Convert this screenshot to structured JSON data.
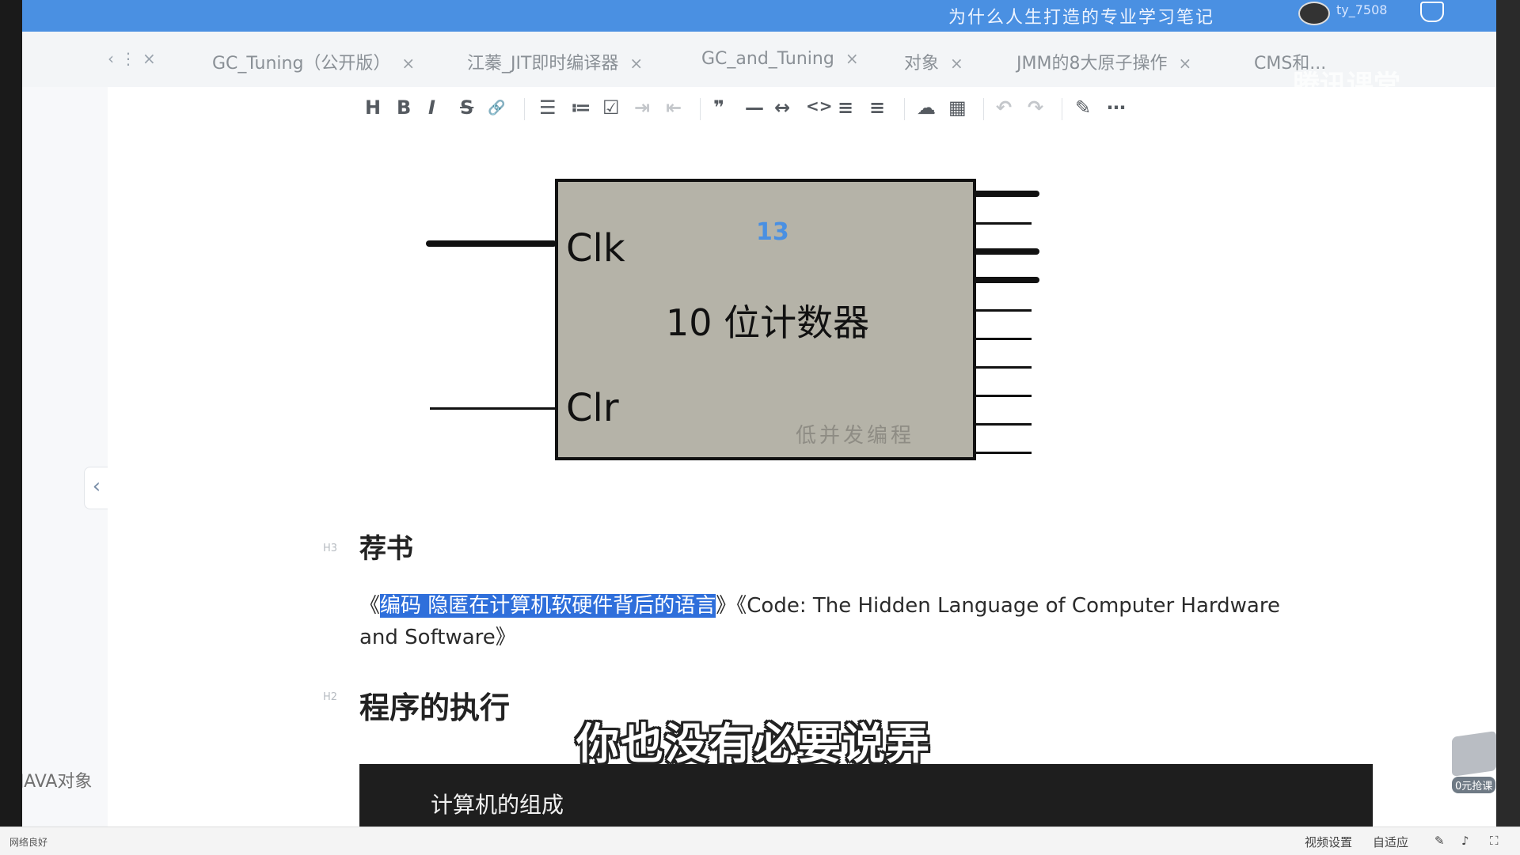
{
  "window": {
    "title": "为什么人生打造的专业学习笔记",
    "username": "ty_7508"
  },
  "tabs": [
    {
      "label": "GC_Tuning（公开版）"
    },
    {
      "label": "江蓁_JIT即时编译器"
    },
    {
      "label": "GC_and_Tuning"
    },
    {
      "label": "对象"
    },
    {
      "label": "JMM的8大原子操作"
    },
    {
      "label": "CMS和..."
    }
  ],
  "tab_nav": {
    "prev": "‹",
    "more": "⋮",
    "close": "×"
  },
  "watermark": "腾讯课堂",
  "sidebar": {
    "item": "JAVA对象",
    "collapse": "‹"
  },
  "toolbar": {
    "buttons": [
      "H",
      "B",
      "I",
      "S",
      "🔗",
      "☰",
      "≔",
      "☑",
      "⇥",
      "⇤",
      "❞",
      "—",
      "↔",
      "<>",
      "≡",
      "≡",
      "☁",
      "▦",
      "↶",
      "↷",
      "✎",
      "⋯"
    ]
  },
  "diagram": {
    "number": "13",
    "title": "10 位计数器",
    "clk": "Clk",
    "clr": "Clr",
    "watermark": "低并发编程"
  },
  "doc": {
    "h3_tag": "H3",
    "h3": "荐书",
    "para_open": "《",
    "para_highlight": "编码 隐匿在计算机软硬件背后的语言",
    "para_rest": "》《Code: The Hidden Language of Computer Hardware and Software》",
    "h2_tag": "H2",
    "h2": "程序的执行",
    "code_text": "计算机的组成"
  },
  "subtitle": "你也没有必要说弄",
  "float_button": "0元抢课",
  "statusbar": {
    "network": "网络良好",
    "video_settings": "视频设置",
    "adaptive": "自适应"
  },
  "colors": {
    "titlebar": "#4a90e2",
    "chip_fill": "#b5b3a8",
    "highlight": "#2f6fdb"
  }
}
